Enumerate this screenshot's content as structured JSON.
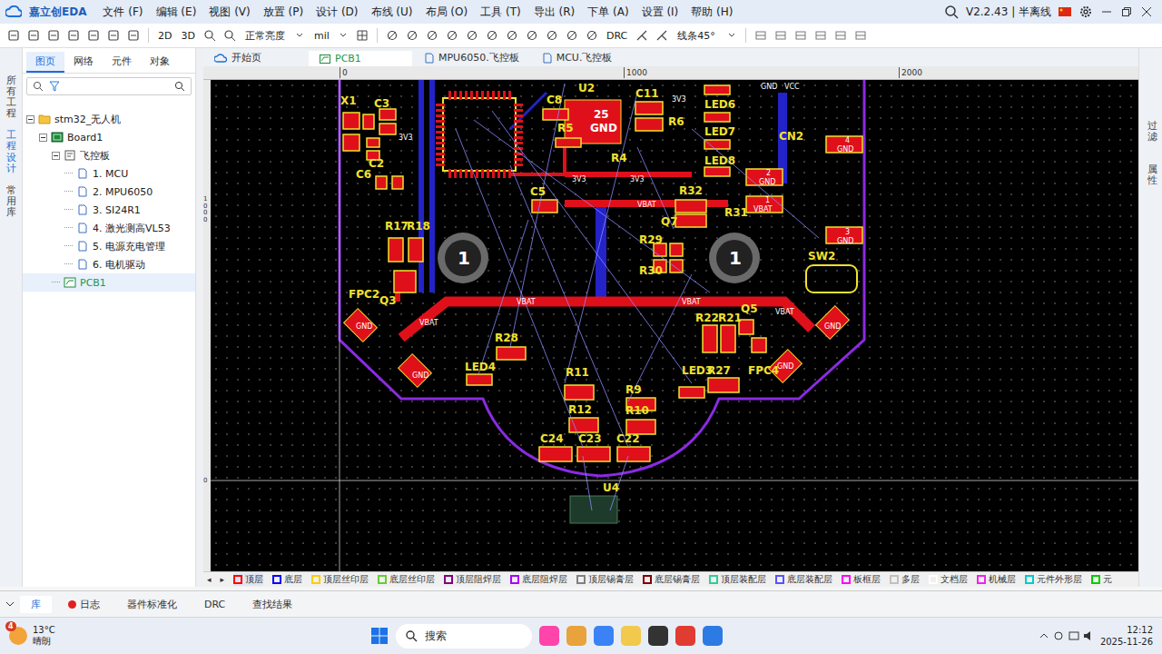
{
  "titlebar": {
    "logo": "嘉立创EDA",
    "menus": [
      "文件 (F)",
      "编辑 (E)",
      "视图 (V)",
      "放置 (P)",
      "设计 (D)",
      "布线 (U)",
      "布局 (O)",
      "工具 (T)",
      "导出 (R)",
      "下单 (A)",
      "设置 (I)",
      "帮助 (H)"
    ],
    "version": "V2.2.43 | 半离线"
  },
  "toolbar": {
    "view2d": "2D",
    "view3d": "3D",
    "brightness": "正常亮度",
    "unit": "mil",
    "drc": "DRC",
    "lineMode": "线条45°"
  },
  "leftRail": [
    {
      "label": "所有工程",
      "selected": false
    },
    {
      "label": "工程设计",
      "selected": true
    },
    {
      "label": "常用库",
      "selected": false
    }
  ],
  "panelTabs": [
    {
      "label": "图页",
      "selected": true
    },
    {
      "label": "网络",
      "selected": false
    },
    {
      "label": "元件",
      "selected": false
    },
    {
      "label": "对象",
      "selected": false
    }
  ],
  "tree": [
    {
      "label": "stm32_无人机",
      "level": 0,
      "kind": "folder",
      "expanded": true,
      "selected": false
    },
    {
      "label": "Board1",
      "level": 1,
      "kind": "board",
      "expanded": true,
      "selected": false
    },
    {
      "label": "飞控板",
      "level": 2,
      "kind": "schematic",
      "expanded": true,
      "selected": false
    },
    {
      "label": "1. MCU",
      "level": 3,
      "kind": "sheet",
      "expanded": false,
      "selected": false
    },
    {
      "label": "2. MPU6050",
      "level": 3,
      "kind": "sheet",
      "expanded": false,
      "selected": false
    },
    {
      "label": "3. SI24R1",
      "level": 3,
      "kind": "sheet",
      "expanded": false,
      "selected": false
    },
    {
      "label": "4. 激光测高VL53",
      "level": 3,
      "kind": "sheet",
      "expanded": false,
      "selected": false
    },
    {
      "label": "5. 电源充电管理",
      "level": 3,
      "kind": "sheet",
      "expanded": false,
      "selected": false
    },
    {
      "label": "6. 电机驱动",
      "level": 3,
      "kind": "sheet",
      "expanded": false,
      "selected": false
    },
    {
      "label": "PCB1",
      "level": 2,
      "kind": "pcb",
      "expanded": false,
      "selected": true
    }
  ],
  "docTabs": [
    {
      "label": "开始页",
      "selected": false,
      "kind": "home"
    },
    {
      "label": "PCB1",
      "selected": true,
      "kind": "pcb"
    },
    {
      "label": "MPU6050.飞控板",
      "selected": false,
      "kind": "sheet"
    },
    {
      "label": "MCU.飞控板",
      "selected": false,
      "kind": "sheet"
    }
  ],
  "rulerTop": [
    "0",
    "1000",
    "2000"
  ],
  "rulerLeft": [
    "1000",
    "0"
  ],
  "canvasLabels": [
    {
      "text": "X1",
      "kind": "silk"
    },
    {
      "text": "C3",
      "kind": "silk"
    },
    {
      "text": "C2",
      "kind": "silk"
    },
    {
      "text": "C6",
      "kind": "silk"
    },
    {
      "text": "3V3",
      "kind": "net"
    },
    {
      "text": "C8",
      "kind": "silk"
    },
    {
      "text": "U2",
      "kind": "silk"
    },
    {
      "text": "C11",
      "kind": "silk"
    },
    {
      "text": "R5",
      "kind": "silk"
    },
    {
      "text": "25",
      "kind": "pin"
    },
    {
      "text": "GND",
      "kind": "pin"
    },
    {
      "text": "R6",
      "kind": "silk"
    },
    {
      "text": "R4",
      "kind": "silk"
    },
    {
      "text": "3V3",
      "kind": "net"
    },
    {
      "text": "3V3",
      "kind": "net"
    },
    {
      "text": "3V3",
      "kind": "net"
    },
    {
      "text": "LED6",
      "kind": "silk"
    },
    {
      "text": "LED7",
      "kind": "silk"
    },
    {
      "text": "LED8",
      "kind": "silk"
    },
    {
      "text": "GND",
      "kind": "net"
    },
    {
      "text": "VCC",
      "kind": "net"
    },
    {
      "text": "CN2",
      "kind": "silk"
    },
    {
      "text": "2",
      "kind": "net"
    },
    {
      "text": "GND",
      "kind": "net"
    },
    {
      "text": "1",
      "kind": "net"
    },
    {
      "text": "VBAT",
      "kind": "net"
    },
    {
      "text": "4",
      "kind": "net"
    },
    {
      "text": "GND",
      "kind": "net"
    },
    {
      "text": "3",
      "kind": "net"
    },
    {
      "text": "GND",
      "kind": "net"
    },
    {
      "text": "C5",
      "kind": "silk"
    },
    {
      "text": "VBAT",
      "kind": "net"
    },
    {
      "text": "R32",
      "kind": "silk"
    },
    {
      "text": "Q7",
      "kind": "silk"
    },
    {
      "text": "R31",
      "kind": "silk"
    },
    {
      "text": "R29",
      "kind": "silk"
    },
    {
      "text": "R30",
      "kind": "silk"
    },
    {
      "text": "R17",
      "kind": "silk"
    },
    {
      "text": "R18",
      "kind": "silk"
    },
    {
      "text": "1",
      "kind": "hole"
    },
    {
      "text": "1",
      "kind": "hole"
    },
    {
      "text": "SW2",
      "kind": "silk"
    },
    {
      "text": "VBAT",
      "kind": "net"
    },
    {
      "text": "VBAT",
      "kind": "net"
    },
    {
      "text": "FPC2",
      "kind": "silk"
    },
    {
      "text": "Q3",
      "kind": "silk"
    },
    {
      "text": "R22",
      "kind": "silk"
    },
    {
      "text": "R21",
      "kind": "silk"
    },
    {
      "text": "Q5",
      "kind": "silk"
    },
    {
      "text": "FPC4",
      "kind": "silk"
    },
    {
      "text": "GND",
      "kind": "net"
    },
    {
      "text": "GND",
      "kind": "net"
    },
    {
      "text": "GND",
      "kind": "net"
    },
    {
      "text": "GND",
      "kind": "net"
    },
    {
      "text": "R28",
      "kind": "silk"
    },
    {
      "text": "LED4",
      "kind": "silk"
    },
    {
      "text": "R11",
      "kind": "silk"
    },
    {
      "text": "LED3",
      "kind": "silk"
    },
    {
      "text": "R27",
      "kind": "silk"
    },
    {
      "text": "R9",
      "kind": "silk"
    },
    {
      "text": "R12",
      "kind": "silk"
    },
    {
      "text": "R10",
      "kind": "silk"
    },
    {
      "text": "C24",
      "kind": "silk"
    },
    {
      "text": "C23",
      "kind": "silk"
    },
    {
      "text": "C22",
      "kind": "silk"
    },
    {
      "text": "U4",
      "kind": "silk"
    },
    {
      "text": "VBAT",
      "kind": "net"
    },
    {
      "text": "VBAT",
      "kind": "net"
    }
  ],
  "layerNav": [
    "◂",
    "▸"
  ],
  "layers": [
    {
      "label": "顶层",
      "color": "#ff0000",
      "selected": true
    },
    {
      "label": "底层",
      "color": "#0000ff",
      "selected": false
    },
    {
      "label": "顶层丝印层",
      "color": "#ffcc00",
      "selected": false
    },
    {
      "label": "底层丝印层",
      "color": "#66cc33",
      "selected": false
    },
    {
      "label": "顶层阻焊层",
      "color": "#800080",
      "selected": false
    },
    {
      "label": "底层阻焊层",
      "color": "#aa00ff",
      "selected": false
    },
    {
      "label": "顶层锡膏层",
      "color": "#808080",
      "selected": false
    },
    {
      "label": "底层锡膏层",
      "color": "#800000",
      "selected": false
    },
    {
      "label": "顶层装配层",
      "color": "#33cc99",
      "selected": false
    },
    {
      "label": "底层装配层",
      "color": "#5555ff",
      "selected": false
    },
    {
      "label": "板框层",
      "color": "#ff00ff",
      "selected": false
    },
    {
      "label": "多层",
      "color": "#c0c0c0",
      "selected": false
    },
    {
      "label": "文档层",
      "color": "#ffffff",
      "selected": false
    },
    {
      "label": "机械层",
      "color": "#f022f0",
      "selected": false
    },
    {
      "label": "元件外形层",
      "color": "#00cccc",
      "selected": false
    },
    {
      "label": "元",
      "color": "#00cc00",
      "selected": false
    }
  ],
  "rightRail": [
    "过滤",
    "属性"
  ],
  "bottomTabs": [
    {
      "label": "库",
      "selected": true,
      "kind": "plain"
    },
    {
      "label": "日志",
      "selected": false,
      "kind": "dot"
    },
    {
      "label": "器件标准化",
      "selected": false,
      "kind": "plain"
    },
    {
      "label": "DRC",
      "selected": false,
      "kind": "plain"
    },
    {
      "label": "查找结果",
      "selected": false,
      "kind": "plain"
    }
  ],
  "taskbar": {
    "badge": "4",
    "temp": "13°C",
    "weather": "晴朗",
    "search": "搜索",
    "time": "12:12",
    "date": "2025-11-26"
  }
}
